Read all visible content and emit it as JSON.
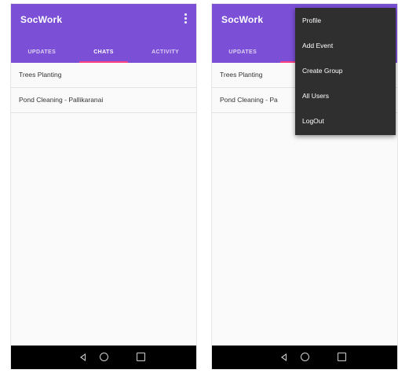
{
  "app": {
    "title": "SocWork"
  },
  "tabs": [
    {
      "label": "UPDATES"
    },
    {
      "label": "CHATS"
    },
    {
      "label": "ACTIVITY"
    }
  ],
  "chats": [
    {
      "name": "Trees Planting"
    },
    {
      "name": "Pond Cleaning - Pallikaranai"
    }
  ],
  "right_tabs": [
    {
      "label": "UPDATES"
    }
  ],
  "right_chats": [
    {
      "name": "Trees Planting"
    },
    {
      "name": "Pond Cleaning - Pa"
    }
  ],
  "menu": {
    "items": [
      {
        "label": "Profile"
      },
      {
        "label": "Add Event"
      },
      {
        "label": "Create Group"
      },
      {
        "label": "All Users"
      },
      {
        "label": "LogOut"
      }
    ]
  },
  "colors": {
    "primary": "#7b4fd6",
    "accent": "#ff4081",
    "menu_bg": "#2f2f2f",
    "nav_bg": "#000000"
  },
  "icons": {
    "overflow": "more-vert-icon",
    "nav_back": "back-triangle-icon",
    "nav_home": "home-circle-icon",
    "nav_recent": "recent-square-icon"
  }
}
